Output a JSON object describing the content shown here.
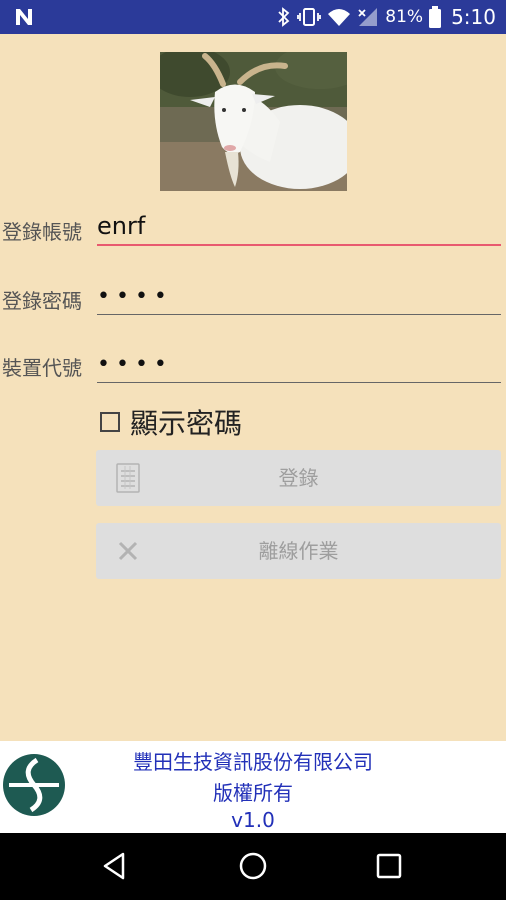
{
  "status_bar": {
    "notification_icon": "n-icon",
    "battery_percent": "81%",
    "time": "5:10",
    "colors": {
      "background": "#2b3a99"
    }
  },
  "login_form": {
    "account_label": "登錄帳號",
    "account_value": "enrf",
    "password_label": "登錄密碼",
    "password_value": "••••",
    "device_label": "裝置代號",
    "device_value": "••••",
    "show_password_label": "顯示密碼",
    "show_password_checked": false,
    "login_button_label": "登錄",
    "offline_button_label": "離線作業",
    "colors": {
      "background": "#f5e1bb",
      "focus_underline": "#e8596f",
      "button": "#dedede"
    }
  },
  "footer": {
    "company": "豐田生技資訊股份有限公司",
    "copyright": "版權所有",
    "version": "v1.0",
    "text_color": "#2230b8"
  }
}
